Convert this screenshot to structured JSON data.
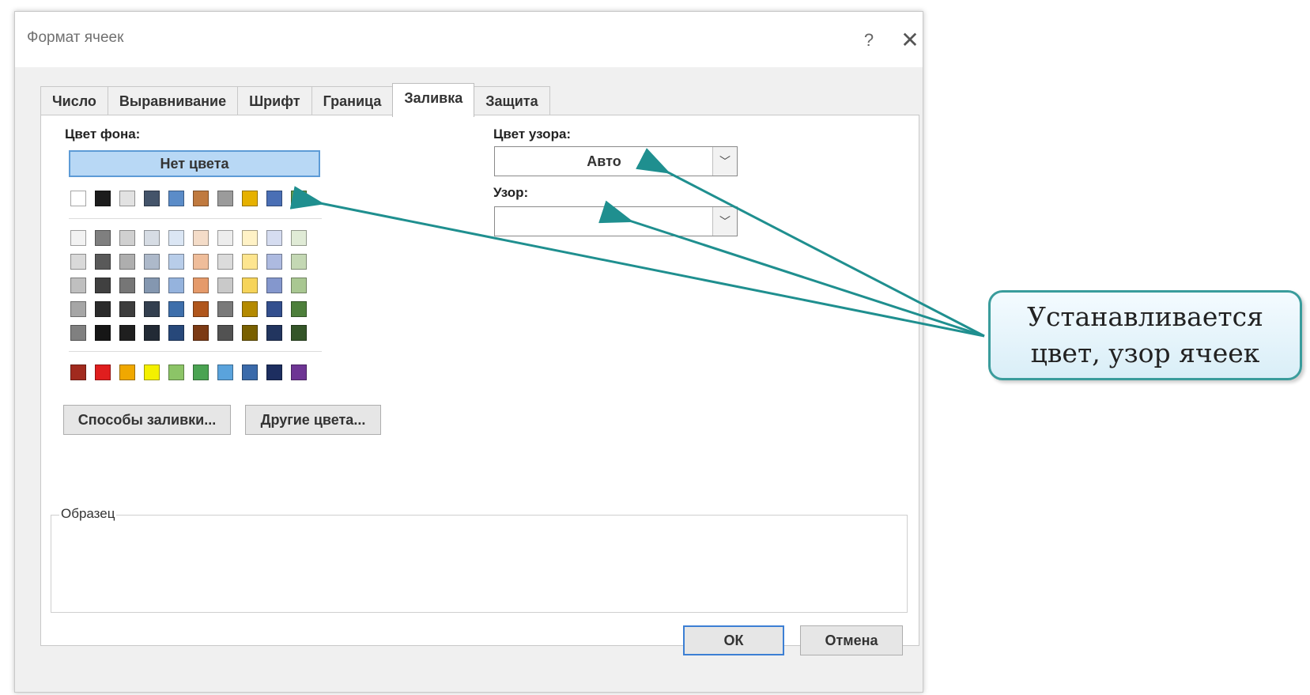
{
  "dialog": {
    "title": "Формат ячеек",
    "help_label": "?",
    "close_label": "✕"
  },
  "tabs": [
    {
      "label": "Число"
    },
    {
      "label": "Выравнивание"
    },
    {
      "label": "Шрифт"
    },
    {
      "label": "Граница"
    },
    {
      "label": "Заливка",
      "active": true
    },
    {
      "label": "Защита"
    }
  ],
  "fill": {
    "background_color_label": "Цвет фона:",
    "no_color_label": "Нет цвета",
    "swatch_rows": [
      [
        "#ffffff",
        "#1c1c1c",
        "#e2e2e2",
        "#44546a",
        "#5b8cc8",
        "#c07a3f",
        "#9b9b9b",
        "#e6b100",
        "#4a6fb5",
        "#5f9b4c"
      ],
      [
        "#f2f2f2",
        "#7f7f7f",
        "#d0d0d0",
        "#d6dce4",
        "#dbe6f4",
        "#f4dcc8",
        "#ededed",
        "#fff2c6",
        "#d5dcf0",
        "#e0ebd6"
      ],
      [
        "#d9d9d9",
        "#595959",
        "#aeaeae",
        "#adb9ca",
        "#b8cde9",
        "#efbd9a",
        "#dbdbdb",
        "#fde58f",
        "#adbae0",
        "#c4d8b4"
      ],
      [
        "#bfbfbf",
        "#404040",
        "#767676",
        "#8497b0",
        "#95b3dd",
        "#e59a6a",
        "#c9c9c9",
        "#f6d45a",
        "#8497cd",
        "#a9c792"
      ],
      [
        "#a6a6a6",
        "#2b2b2b",
        "#3d3d3d",
        "#333f4f",
        "#3e6fab",
        "#b0561c",
        "#7a7a7a",
        "#b48a00",
        "#334f8e",
        "#4d7f3b"
      ],
      [
        "#808080",
        "#161616",
        "#1f1f1f",
        "#222a35",
        "#27487a",
        "#7c3a14",
        "#525252",
        "#796000",
        "#22355f",
        "#345528"
      ],
      [
        "#a12a1e",
        "#e01e1e",
        "#f0a800",
        "#f4f000",
        "#8cc467",
        "#4aa352",
        "#5aa3dc",
        "#3a6aaa",
        "#1d2e60",
        "#6e3594"
      ]
    ],
    "fill_effects_button": "Способы заливки...",
    "more_colors_button": "Другие цвета...",
    "pattern_color_label": "Цвет узора:",
    "pattern_color_value": "Авто",
    "pattern_style_label": "Узор:",
    "pattern_style_value": "",
    "dropdown_glyph": "﹀"
  },
  "sample": {
    "label": "Образец"
  },
  "footer": {
    "ok_label": "ОК",
    "cancel_label": "Отмена"
  },
  "callout": {
    "line1": "Устанавливается",
    "line2": "цвет, узор ячеек"
  },
  "colors": {
    "arrow": "#1f8f8f",
    "accent": "#3c7fd4"
  }
}
